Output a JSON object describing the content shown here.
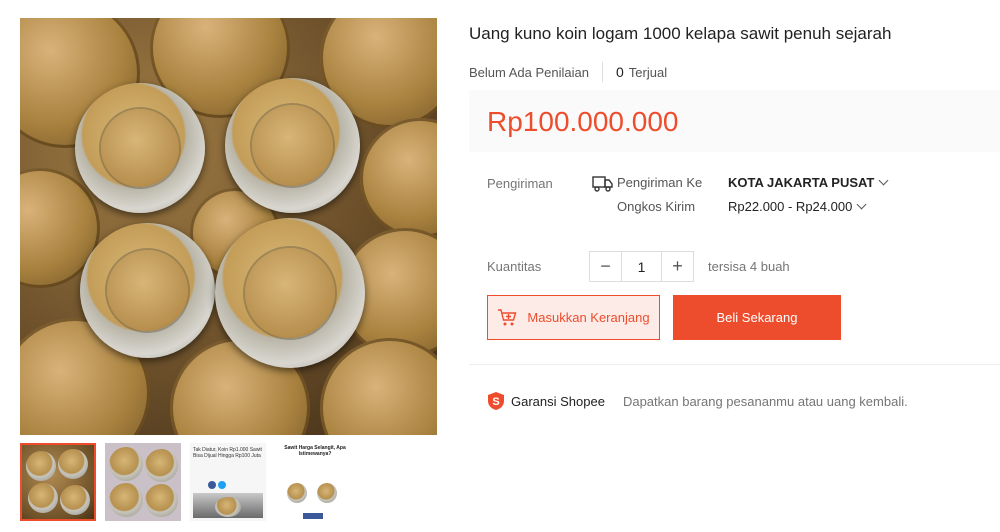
{
  "product": {
    "title": "Uang kuno koin logam 1000 kelapa sawit penuh sejarah",
    "rating_text": "Belum Ada Penilaian",
    "sold_count": "0",
    "sold_label": "Terjual",
    "price": "Rp100.000.000"
  },
  "shipping": {
    "label": "Pengiriman",
    "to_label": "Pengiriman Ke",
    "to_value": "KOTA JAKARTA PUSAT",
    "cost_label": "Ongkos Kirim",
    "cost_value": "Rp22.000 - Rp24.000"
  },
  "quantity": {
    "label": "Kuantitas",
    "minus": "−",
    "value": "1",
    "plus": "+",
    "stock": "tersisa 4 buah"
  },
  "actions": {
    "add_to_cart": "Masukkan Keranjang",
    "buy_now": "Beli Sekarang"
  },
  "guarantee": {
    "label": "Garansi Shopee",
    "description": "Dapatkan barang pesananmu atau uang kembali."
  },
  "thumbnails": {
    "t3_title": "Tak Diatur, Koin Rp1.000 Sawit Bisa Dijual Hingga Rp100 Juta",
    "t4_title": "Sawit Harga Selangit, Apa Istimewanya?"
  },
  "colors": {
    "accent": "#ee4d2d",
    "price_bg": "#fafafa"
  }
}
